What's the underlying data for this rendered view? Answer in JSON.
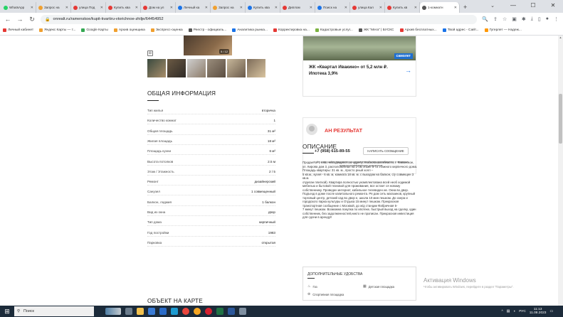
{
  "browser": {
    "tabs": [
      {
        "label": "WhatsApp",
        "color": "#25d366"
      },
      {
        "label": "Запрос на",
        "color": "#f0a030"
      },
      {
        "label": "улица Под",
        "color": "#e53935"
      },
      {
        "label": "Купить ква",
        "color": "#e53935"
      },
      {
        "label": "Дом на ул",
        "color": "#e53935"
      },
      {
        "label": "Личный ка",
        "color": "#1a73e8"
      },
      {
        "label": "Запрос на",
        "color": "#f0a030"
      },
      {
        "label": "Купить ква",
        "color": "#1a73e8"
      },
      {
        "label": "Диплом",
        "color": "#e53935"
      },
      {
        "label": "Поиск на",
        "color": "#1a73e8"
      },
      {
        "label": "улица Кал",
        "color": "#e53935"
      },
      {
        "label": "Купить кв",
        "color": "#e53935"
      },
      {
        "label": "1-комнатн",
        "color": "#555555",
        "active": true
      }
    ],
    "new_tab": "+",
    "url": "onrealt.ru/ramenskoe/kupit-kvartiru-vtorichnoe-zhilje/64454952",
    "window_controls": [
      "—",
      "☐",
      "✕"
    ]
  },
  "bookmarks": [
    {
      "label": "Личный кабинет",
      "color": "#e53935"
    },
    {
      "label": "Яндекс Карты — т...",
      "color": "#f0a030"
    },
    {
      "label": "Google Карты",
      "color": "#34a853"
    },
    {
      "label": "Архив оценщика",
      "color": "#f0a030"
    },
    {
      "label": "Экспресс-оценка",
      "color": "#f0a030"
    },
    {
      "label": "Реестр - официаль...",
      "color": "#555555"
    },
    {
      "label": "Аналитика рынка...",
      "color": "#1a73e8"
    },
    {
      "label": "Корректировка на...",
      "color": "#e53935"
    },
    {
      "label": "Кадастровые услуг...",
      "color": "#7cb342"
    },
    {
      "label": "ЖК \"Мега\" | БУСКС",
      "color": "#555555"
    },
    {
      "label": "Архив бесплатных...",
      "color": "#e53935"
    },
    {
      "label": "Твой адрес - Сайт...",
      "color": "#1a73e8"
    },
    {
      "label": "Гугерлет — Надеж...",
      "color": "#ff9800"
    }
  ],
  "gallery": {
    "counter": "5 / 12"
  },
  "general_info": {
    "title": "ОБЩАЯ ИНФОРМАЦИЯ",
    "rows": [
      {
        "label": "Тип жилья",
        "value": "вторичка"
      },
      {
        "label": "Количество комнат",
        "value": "1"
      },
      {
        "label": "Общая площадь",
        "value": "31 м²"
      },
      {
        "label": "Жилая площадь",
        "value": "18 м²"
      },
      {
        "label": "Площадь кухни",
        "value": "6 м²"
      },
      {
        "label": "Высота потолков",
        "value": "2.5 м"
      },
      {
        "label": "Этаж / Этажность",
        "value": "2 / 5"
      },
      {
        "label": "Ремонт",
        "value": "дизайнерский"
      },
      {
        "label": "Санузел",
        "value": "1 совмещенный"
      },
      {
        "label": "Балкон, лоджия",
        "value": "1 балкон"
      },
      {
        "label": "Вид из окна",
        "value": "двор"
      },
      {
        "label": "Тип дома",
        "value": "кирпичный"
      },
      {
        "label": "Год постройки",
        "value": "1983"
      },
      {
        "label": "Парковка",
        "value": "открытая"
      }
    ]
  },
  "ad": {
    "brand": "самолет",
    "text": "ЖК «Квартал Ивакино» от 5,2 млн ₽. Ипотека 3,9%"
  },
  "agent": {
    "name": "АН РЕЗУЛЬТАТ",
    "phone": "+7 (958) 615-89-55",
    "message_button": "НАПИСАТЬ СООБЩЕНИЕ",
    "note": "Не совершайте предоплату до просмотра объекта недвижимости и проверки правоустанавливающих документов"
  },
  "description": {
    "title": "ОПИСАНИЕ",
    "text": "Продается 1 к.кв., находящаяся по адресу: Московская область, г. Раменское, ул. Кирова дом 3, расположенная на 2-ом этаже 5-ти этажного кирпичного дома. Площадь квартиры: 31 кв. м., просто рный холл –\n 5 кв.м., кухня - 6 кв. м, комната 18 кв. м. с выходом на балкон, с/у совмещен 3 кв.м.\nотделан плиткой). Квартира полностью укомплектована всей необ ходимой мебелью и бытовой техникой для проживания, все остает ся новому собственнику. Проведен интернет, кабельное телевиден ие. Окна во двор. Подъезд в доме после капитального ремонта. Ря дом сеть магазинов, крупный торговый центр, детский сад во двор е, школа 10 мин пешком. До озера и городского парка культуры и Отдыха 15 минут пешком. Прекрасная транспортная сообщение с Москвой, до ж/д станции Фабричная 5-\n7 минут пешком. Возможна покупка по ипотеке, быстрый выход на сделку, один собственник, без задолженностей,никто не прописан. Прекрасная инвестиция для сдачи в аренду!!"
  },
  "amenities": {
    "title": "ДОПОЛНИТЕЛЬНЫЕ УДОБСТВА",
    "items": [
      "Газ",
      "Детская площадка",
      "Спортивная площадка"
    ]
  },
  "location": {
    "title": "ОБЪЕКТ НА КАРТЕ"
  },
  "windows_activation": {
    "title": "Активация Windows",
    "subtitle": "Чтобы активировать Windows, перейдите в раздел \"Параметры\"."
  },
  "taskbar": {
    "search_placeholder": "Поиск",
    "language": "РУС",
    "time": "11:13",
    "date": "11.08.2023"
  }
}
